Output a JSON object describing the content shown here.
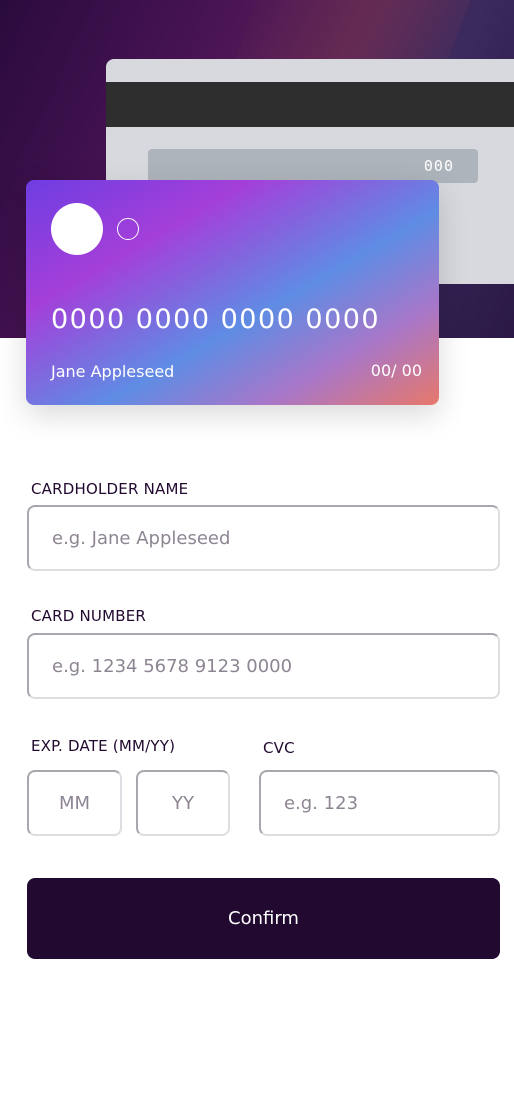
{
  "card_back": {
    "cvc": "000"
  },
  "card_front": {
    "number": "0000 0000 0000 0000",
    "name": "Jane Appleseed",
    "expiry": "00/ 00"
  },
  "form": {
    "name": {
      "label": "CARDHOLDER NAME",
      "placeholder": "e.g. Jane Appleseed"
    },
    "number": {
      "label": "CARD NUMBER",
      "placeholder": "e.g. 1234 5678 9123 0000"
    },
    "expiry": {
      "label": "EXP. DATE (MM/YY)",
      "month_placeholder": "MM",
      "year_placeholder": "YY"
    },
    "cvc": {
      "label": "CVC",
      "placeholder": "e.g. 123"
    },
    "confirm_label": "Confirm"
  },
  "colors": {
    "accent_dark": "#21092f",
    "card_gradient_start": "#6e3de2",
    "card_gradient_end": "#e7786a"
  }
}
